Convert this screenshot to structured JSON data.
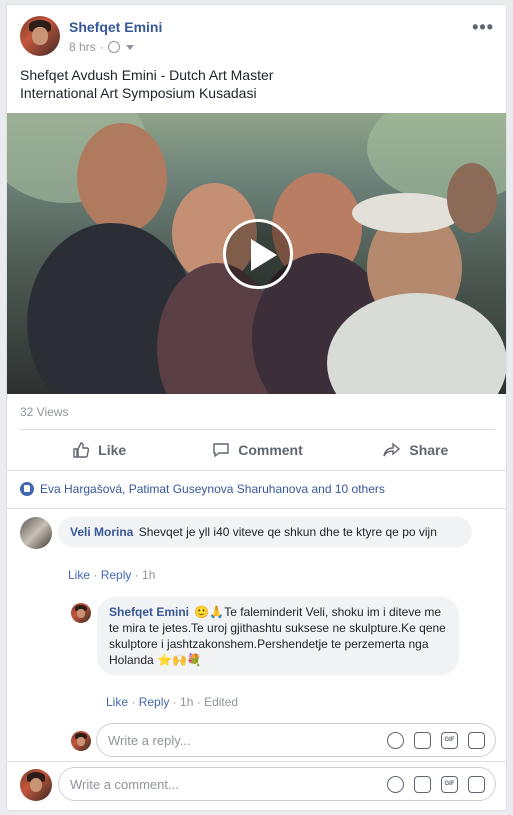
{
  "post": {
    "author": "Shefqet Emini",
    "time": "8 hrs",
    "text_line1": "Shefqet Avdush Emini - Dutch Art Master",
    "text_line2": "International Art Symposium Kusadasi",
    "views": "32 Views",
    "more_icon": "more-dots-icon"
  },
  "actions": {
    "like": "Like",
    "comment": "Comment",
    "share": "Share"
  },
  "reactions": {
    "text": "Eva Hargašová, Patimat Guseynova Sharuhanova and 10 others"
  },
  "comments": [
    {
      "author": "Veli Morina",
      "text": "Shevqet je yll i40 viteve qe shkun dhe te ktyre qe po vijn",
      "like": "Like",
      "reply": "Reply",
      "time": "1h"
    }
  ],
  "reply": {
    "author": "Shefqet Emini",
    "text": "🙂🙏Te faleminderit Veli, shoku im i diteve me te mira te jetes.Te uroj gjithashtu suksese ne skulpture.Ke qene skulptore i jashtzakonshem.Pershendetje te perzemerta nga Holanda ⭐🙌💐",
    "like": "Like",
    "reply": "Reply",
    "time": "1h",
    "edited": "Edited"
  },
  "reply_input": {
    "placeholder": "Write a reply..."
  },
  "comment_input": {
    "placeholder": "Write a comment..."
  },
  "colors": {
    "link": "#365899",
    "accent": "#4267b2",
    "muted": "#90949c"
  }
}
